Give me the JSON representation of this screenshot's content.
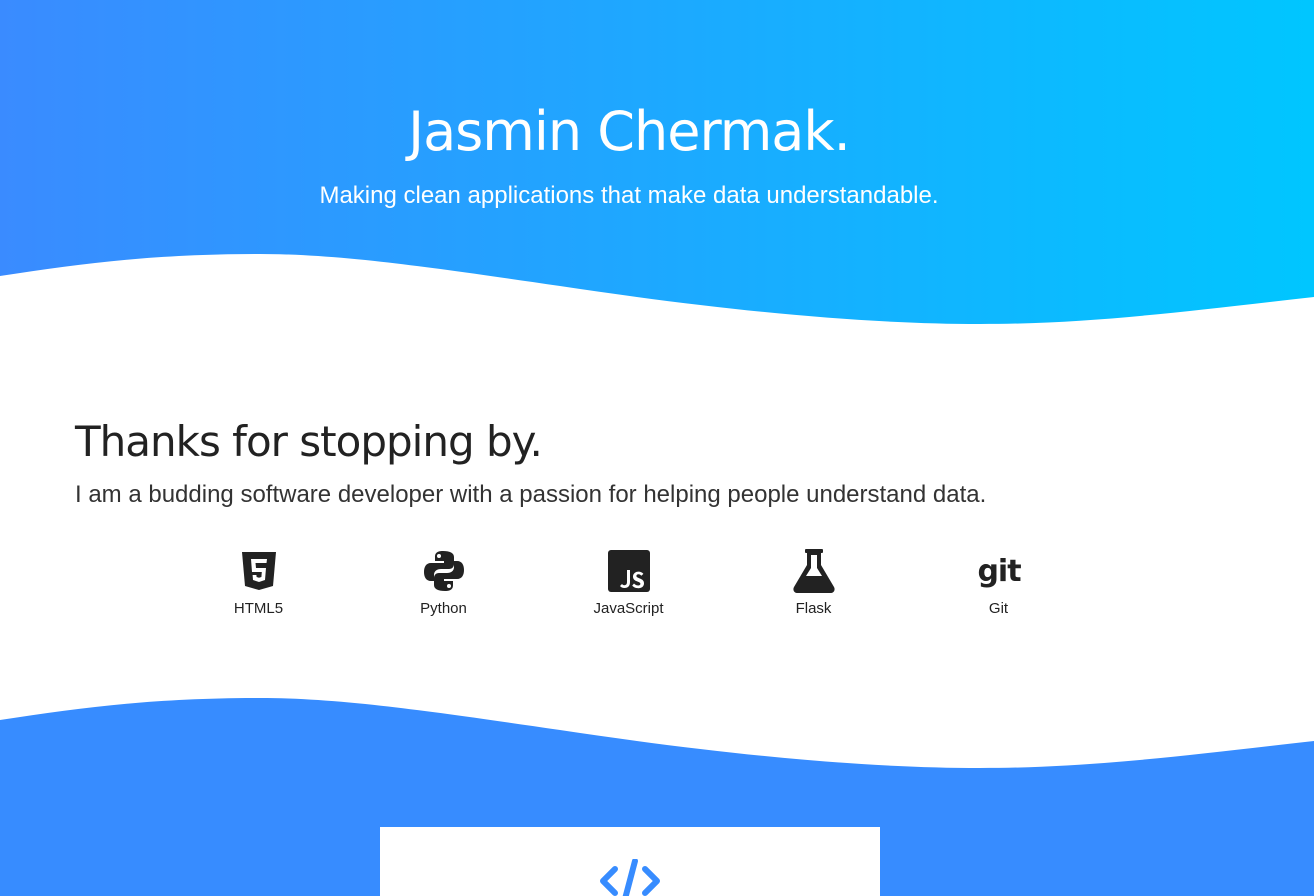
{
  "hero": {
    "title": "Jasmin Chermak.",
    "subtitle": "Making clean applications that make data understandable.",
    "gradient_start": "#3a8bff",
    "gradient_end": "#00c6ff"
  },
  "about": {
    "heading": "Thanks for stopping by.",
    "text": "I am a budding software developer with a passion for helping people understand data."
  },
  "skills": [
    {
      "label": "HTML5",
      "icon": "html5-icon"
    },
    {
      "label": "Python",
      "icon": "python-icon"
    },
    {
      "label": "JavaScript",
      "icon": "javascript-icon"
    },
    {
      "label": "Flask",
      "icon": "flask-icon"
    },
    {
      "label": "Git",
      "icon": "git-icon"
    }
  ],
  "footer": {
    "background": "#378cff",
    "card_icon": "code-icon"
  }
}
